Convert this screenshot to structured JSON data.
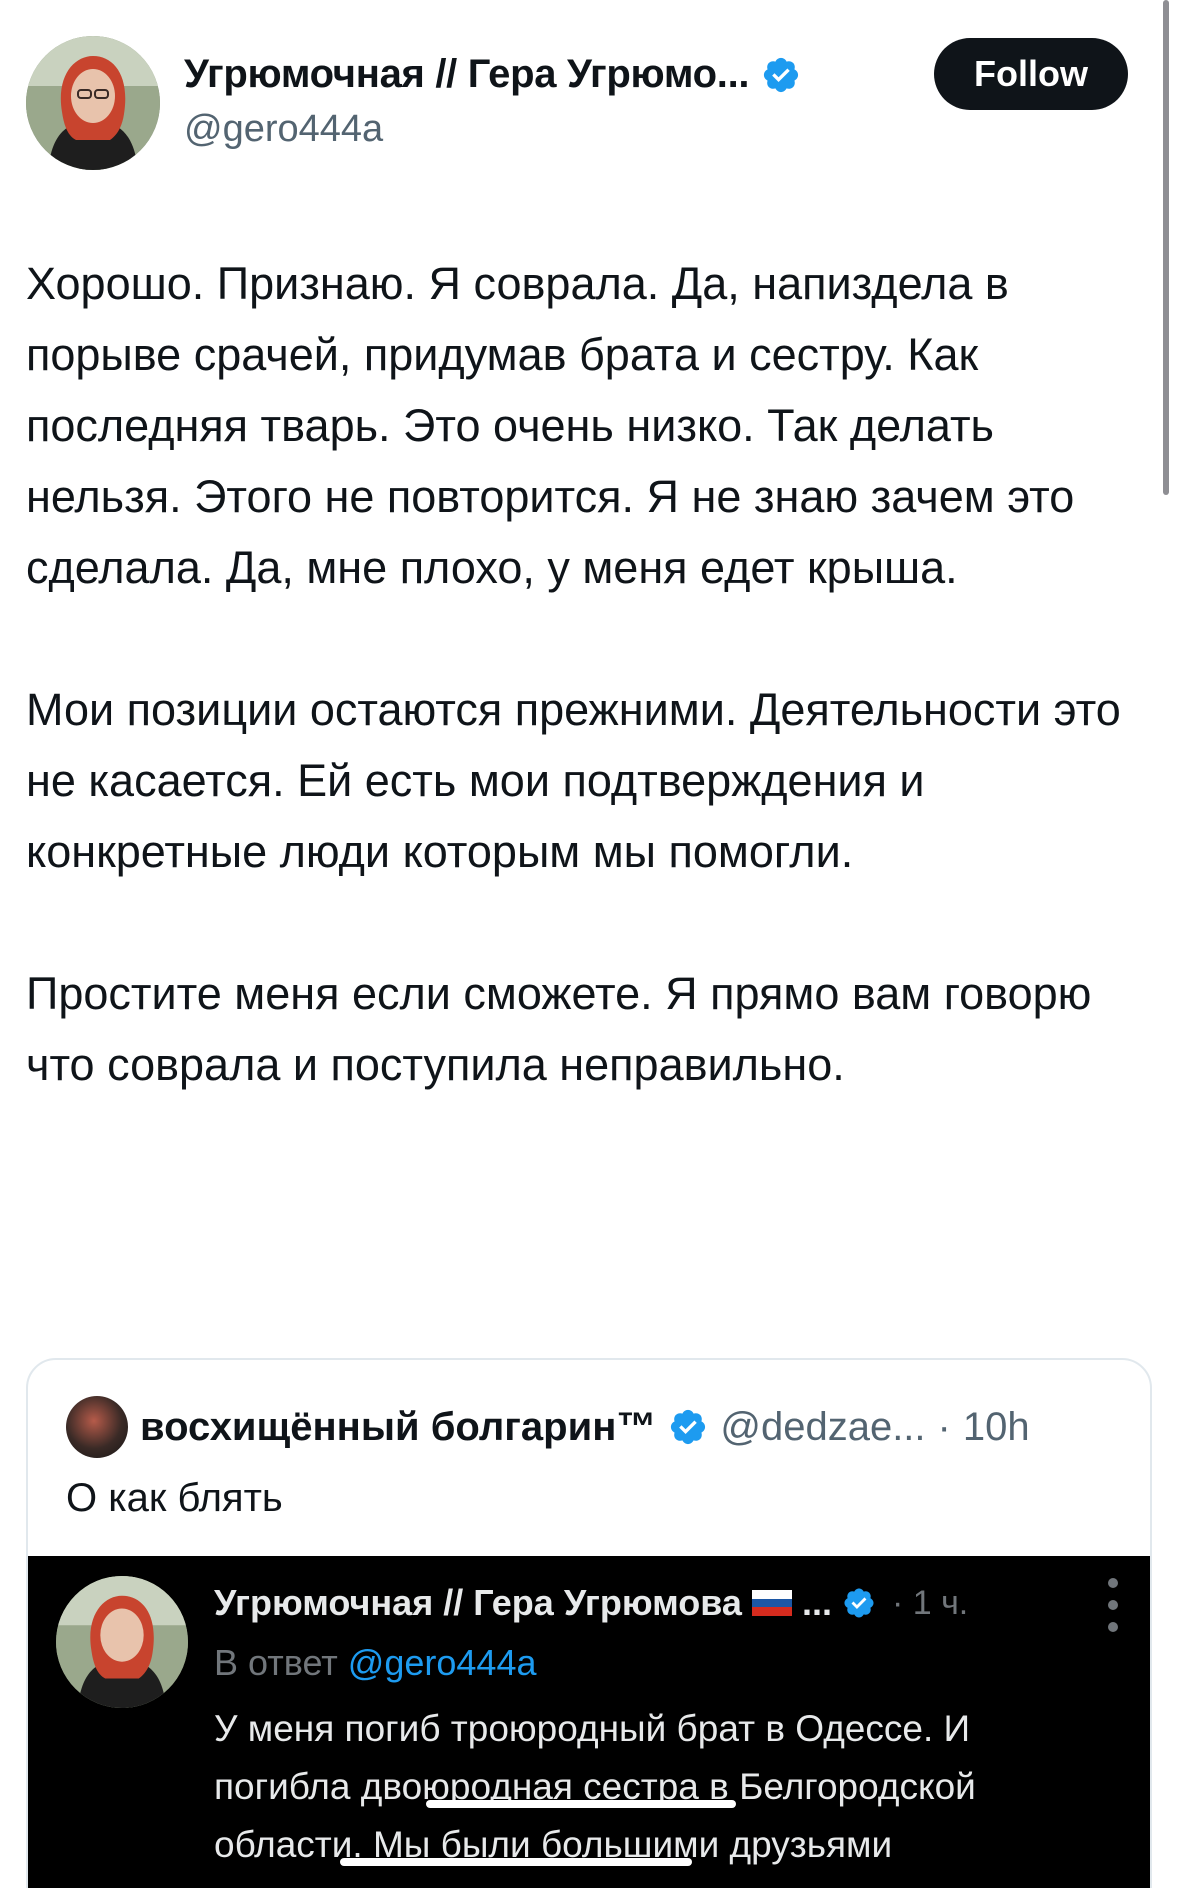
{
  "tweet": {
    "display_name": "Угрюмочная // Гера Угрюмо...",
    "handle": "@gero444a",
    "follow_label": "Follow",
    "paragraphs": [
      "Хорошо. Признаю. Я соврала. Да, напиздела в порыве срачей, придумав брата и сестру. Как последняя тварь. Это очень низко. Так делать нельзя. Этого не повторится. Я не знаю зачем это сделала. Да, мне плохо, у меня едет крыша.",
      "Мои позиции остаются прежними. Деятельности это не касается. Ей есть мои подтверждения и конкретные люди которым мы помогли.",
      "Простите меня если сможете. Я прямо вам говорю что соврала и поступила неправильно."
    ]
  },
  "quote": {
    "name": "восхищённый болгарин™",
    "handle": "@dedzae...",
    "separator": "·",
    "time": "10h",
    "text": "О как блять",
    "screenshot": {
      "name": "Угрюмочная // Гера Угрюмова",
      "ellipsis": "...",
      "time": "· 1 ч.",
      "reply_prefix": "В ответ",
      "reply_mention": "@gero444a",
      "text": "У меня погиб троюродный брат в Одессе. И погибла двоюродная сестра в Белгородской области. Мы были большими друзьями"
    }
  },
  "colors": {
    "text": "#0f1419",
    "secondary": "#536471",
    "verified": "#1d9bf0",
    "follow_bg": "#0f1419",
    "follow_text": "#ffffff"
  },
  "icons": [
    "verified-badge-icon",
    "more-options-icon",
    "russia-flag-icon"
  ]
}
